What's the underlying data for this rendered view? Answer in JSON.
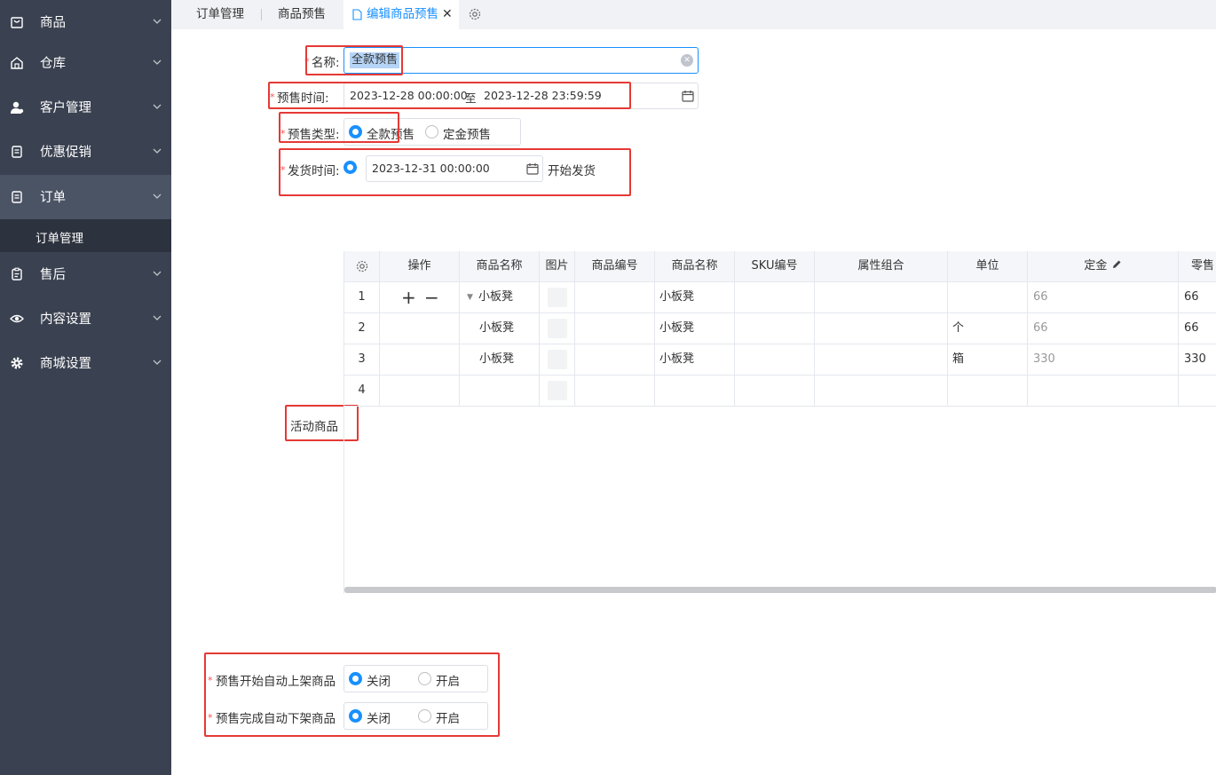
{
  "sidebar": {
    "items": [
      {
        "label": "商品",
        "icon": "product-icon"
      },
      {
        "label": "仓库",
        "icon": "warehouse-icon"
      },
      {
        "label": "客户管理",
        "icon": "customer-icon"
      },
      {
        "label": "优惠促销",
        "icon": "promotion-icon"
      },
      {
        "label": "订单",
        "icon": "order-icon"
      },
      {
        "label": "售后",
        "icon": "aftersale-icon"
      },
      {
        "label": "内容设置",
        "icon": "eye-icon"
      },
      {
        "label": "商城设置",
        "icon": "gear-icon"
      }
    ],
    "sub_item": "订单管理"
  },
  "tabs": [
    "订单管理",
    "商品预售",
    "编辑商品预售"
  ],
  "form": {
    "name_label": "名称:",
    "name_value": "全款预售",
    "presale_time_label": "预售时间:",
    "presale_start": "2023-12-28 00:00:00",
    "presale_to": "至",
    "presale_end": "2023-12-28 23:59:59",
    "presale_type_label": "预售类型:",
    "presale_type_options": [
      "全款预售",
      "定金预售"
    ],
    "presale_type_selected": "全款预售",
    "ship_time_label": "发货时间:",
    "ship_time_value": "2023-12-31 00:00:00",
    "ship_time_suffix": "开始发货",
    "activity_goods_label": "活动商品",
    "auto_on_shelf_label": "预售开始自动上架商品",
    "auto_off_shelf_label": "预售完成自动下架商品",
    "toggle_options": [
      "关闭",
      "开启"
    ],
    "auto_on_shelf_selected": "关闭",
    "auto_off_shelf_selected": "关闭"
  },
  "table": {
    "headers": [
      "操作",
      "商品名称",
      "图片",
      "商品编号",
      "商品名称",
      "SKU编号",
      "属性组合",
      "单位",
      "定金",
      "零售"
    ],
    "rows": [
      {
        "index": "1",
        "name": "小板凳",
        "name2": "小板凳",
        "unit": "",
        "deposit": "66",
        "retail": "66",
        "has_ops": true,
        "expandable": true
      },
      {
        "index": "2",
        "name": "小板凳",
        "name2": "小板凳",
        "unit": "个",
        "deposit": "66",
        "retail": "66",
        "has_ops": false,
        "expandable": false
      },
      {
        "index": "3",
        "name": "小板凳",
        "name2": "小板凳",
        "unit": "箱",
        "deposit": "330",
        "retail": "330",
        "has_ops": false,
        "expandable": false
      },
      {
        "index": "4",
        "name": "",
        "name2": "",
        "unit": "",
        "deposit": "",
        "retail": "",
        "has_ops": false,
        "expandable": false
      }
    ]
  },
  "colors": {
    "primary": "#1890ff",
    "sidebar": "#3a4150",
    "required": "#ff4d4f",
    "highlight": "#e53935"
  }
}
